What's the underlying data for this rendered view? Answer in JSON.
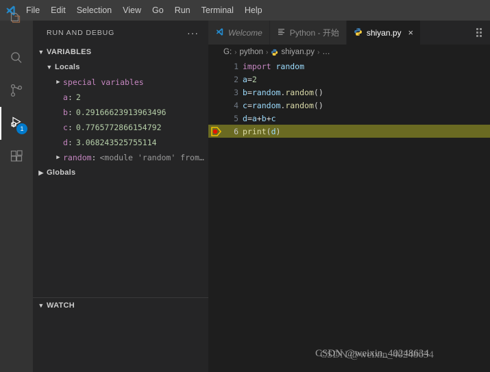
{
  "app": {
    "logo_icon": "vscode-logo-icon",
    "menus": [
      "File",
      "Edit",
      "Selection",
      "View",
      "Go",
      "Run",
      "Terminal",
      "Help"
    ]
  },
  "activitybar": {
    "items": [
      {
        "name": "explorer",
        "icon": "files-icon",
        "active": false,
        "badge": ""
      },
      {
        "name": "search",
        "icon": "search-icon",
        "active": false,
        "badge": ""
      },
      {
        "name": "source-control",
        "icon": "source-control-icon",
        "active": false,
        "badge": ""
      },
      {
        "name": "run-and-debug",
        "icon": "run-and-debug-icon",
        "active": true,
        "badge": "1"
      },
      {
        "name": "extensions",
        "icon": "extensions-icon",
        "active": false,
        "badge": ""
      }
    ]
  },
  "sidebar": {
    "title": "RUN AND DEBUG",
    "more_actions": "···",
    "sections": {
      "variables": "VARIABLES",
      "watch": "WATCH"
    },
    "scopes": {
      "locals": "Locals",
      "globals": "Globals"
    },
    "variables": [
      {
        "expandable": true,
        "name": "special variables",
        "colon": "",
        "value": ""
      },
      {
        "expandable": false,
        "name": "a",
        "colon": ":",
        "value": "2"
      },
      {
        "expandable": false,
        "name": "b",
        "colon": ":",
        "value": "0.29166623913963496"
      },
      {
        "expandable": false,
        "name": "c",
        "colon": ":",
        "value": "0.7765772866154792"
      },
      {
        "expandable": false,
        "name": "d",
        "colon": ":",
        "value": "3.068243525755114"
      },
      {
        "expandable": true,
        "name": "random",
        "colon": ":",
        "value": "<module 'random' from…"
      }
    ]
  },
  "editor": {
    "tabs": [
      {
        "label": "Welcome",
        "icon": "vscode-logo-icon",
        "active": false,
        "italic": true,
        "closable": false
      },
      {
        "label": "Python - 开始",
        "icon": "walkthrough-icon",
        "active": false,
        "italic": false,
        "closable": false
      },
      {
        "label": "shiyan.py",
        "icon": "python-icon",
        "active": true,
        "italic": false,
        "closable": true
      }
    ],
    "close_label": "×",
    "more_actions_icon": "editor-actions-icon",
    "breadcrumb": [
      {
        "label": "G:",
        "icon": ""
      },
      {
        "label": "python",
        "icon": ""
      },
      {
        "label": "shiyan.py",
        "icon": "python-icon"
      },
      {
        "label": "…",
        "icon": ""
      }
    ],
    "breadcrumb_separator": "›",
    "lines": [
      {
        "num": "1",
        "text": "import random",
        "highlight": false,
        "breakpoint": false
      },
      {
        "num": "2",
        "text": "a=2",
        "highlight": false,
        "breakpoint": false
      },
      {
        "num": "3",
        "text": "b=random.random()",
        "highlight": false,
        "breakpoint": false
      },
      {
        "num": "4",
        "text": "c=random.random()",
        "highlight": false,
        "breakpoint": false
      },
      {
        "num": "5",
        "text": "d=a+b+c",
        "highlight": false,
        "breakpoint": false
      },
      {
        "num": "6",
        "text": "print(d)",
        "highlight": true,
        "breakpoint": true
      }
    ]
  },
  "watermark": {
    "text_front": "CSDN @weixin_40248634",
    "text_back": "CSDN @weixin_40248634"
  },
  "colors": {
    "accent": "#007acc",
    "menubar_bg": "#3c3c3c",
    "activitybar_bg": "#333333",
    "sidebar_bg": "#252526",
    "editor_bg": "#1e1e1e",
    "tab_inactive_bg": "#2d2d2d",
    "current_line_bg": "#6a6a22",
    "breakpoint_red": "#e51400",
    "keyword_purple": "#c586c0",
    "identifier_blue": "#9cdcfe",
    "number_green": "#b5cea8",
    "function_yellow": "#dcdcaa",
    "var_name_pink": "#c586c0"
  }
}
